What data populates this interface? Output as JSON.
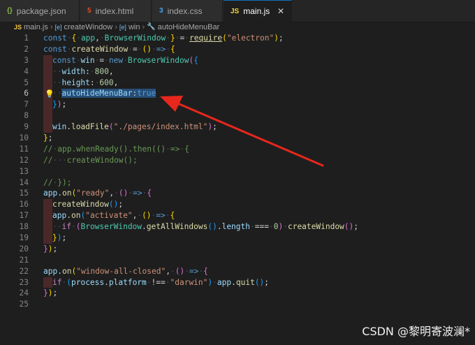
{
  "tabs": [
    {
      "icon": "{}",
      "label": "package.json"
    },
    {
      "icon": "5",
      "label": "index.html"
    },
    {
      "icon": "3",
      "label": "index.css"
    },
    {
      "icon": "JS",
      "label": "main.js",
      "close": "✕"
    }
  ],
  "breadcrumb": {
    "file": "main.js",
    "sep": "›",
    "item1": "createWindow",
    "item2": "win",
    "item3": "autoHideMenuBar",
    "icon1": "[e]",
    "icon2": "[e]",
    "icon3": "wrench"
  },
  "lines": [
    "1",
    "2",
    "3",
    "4",
    "5",
    "6",
    "7",
    "8",
    "9",
    "10",
    "11",
    "12",
    "13",
    "14",
    "15",
    "16",
    "17",
    "18",
    "19",
    "20",
    "21",
    "22",
    "23",
    "24",
    "25"
  ],
  "watermark": "CSDN @黎明寄波澜*",
  "colors": {
    "accent": "#0e70c0",
    "arrow": "#e8271c",
    "selection": "#264f78"
  }
}
